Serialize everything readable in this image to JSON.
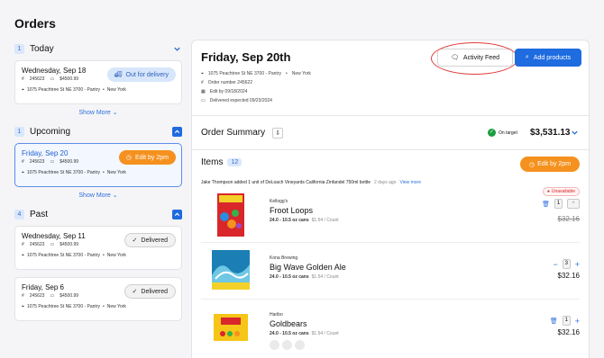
{
  "title": "Orders",
  "left": {
    "today": {
      "num": "1",
      "title": "Today",
      "card": {
        "date": "Wednesday, Sep 18",
        "order": "245623",
        "amount": "$4500.99",
        "address": "1075 Peachtree St NE 3700 - Pantry",
        "city": "New York",
        "badge": "Out for delivery"
      },
      "show_more": "Show More"
    },
    "upcoming": {
      "num": "1",
      "title": "Upcoming",
      "card": {
        "date": "Friday, Sep 20",
        "order": "245623",
        "amount": "$4500.99",
        "address": "1075 Peachtree St NE 3700 - Pantry",
        "city": "New York",
        "badge": "Edit by 2pm"
      },
      "show_more": "Show More"
    },
    "past": {
      "num": "4",
      "title": "Past",
      "cards": [
        {
          "date": "Wednesday, Sep 11",
          "order": "245623",
          "amount": "$4500.99",
          "address": "1075 Peachtree St NE 3700 - Pantry",
          "city": "New York",
          "badge": "Delivered"
        },
        {
          "date": "Friday, Sep 6",
          "order": "245623",
          "amount": "$4500.99",
          "address": "1075 Peachtree St NE 3700 - Pantry",
          "city": "New York",
          "badge": "Delivered"
        }
      ]
    }
  },
  "main": {
    "date": "Friday, Sep 20th",
    "address": "1075 Peachtree St NE 3700 - Pantry",
    "city": "New York",
    "order_number": "Order number  245622",
    "edit_by": "Edit by  09/18/2024",
    "delivered": "Delivered expected  09/23/2024",
    "activity_btn": "Activity Feed",
    "add_btn": "Add products",
    "summary_title": "Order Summary",
    "on_target": "On target",
    "total": "$3,531.13",
    "items_title": "Items",
    "items_count": "12",
    "edit_btn": "Edit by 2pm",
    "activity_text": "Jake Thompson added 1 unit of DeLoach Vineyards California Zinfandel 750ml bottle",
    "activity_time": "2 days ago",
    "activity_link": "View more",
    "products": [
      {
        "brand": "Kellogg's",
        "name": "Froot Loops",
        "size": "24.0 - 10.5 oz cans",
        "unit": "$1.54 / Count",
        "qty": "1",
        "price": "$32.16",
        "status": "Unavailable"
      },
      {
        "brand": "Kona Brewing",
        "name": "Big Wave Golden Ale",
        "size": "24.0 - 10.5 oz cans",
        "unit": "$1.54 / Count",
        "qty": "3",
        "price": "$32.16"
      },
      {
        "brand": "Haribo",
        "name": "Goldbears",
        "size": "24.0 - 10.5 oz cans",
        "unit": "$1.54 / Count",
        "qty": "1",
        "price": "$32.16"
      }
    ]
  },
  "colors": {
    "accent": "#1f6be0",
    "orange": "#f5911e",
    "green": "#1a9e3f",
    "red": "#e03a3a"
  }
}
